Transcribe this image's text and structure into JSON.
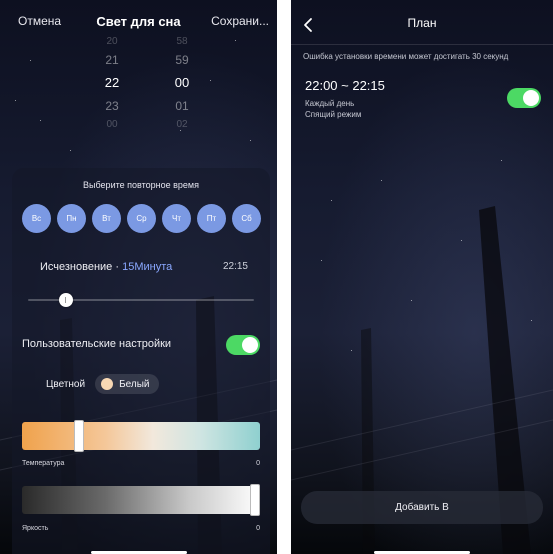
{
  "left_screen": {
    "header": {
      "cancel_label": "Отмена",
      "title": "Свет для сна",
      "save_label": "Сохрани..."
    },
    "time_picker": {
      "hours": [
        "20",
        "21",
        "22",
        "23",
        "00"
      ],
      "minutes": [
        "58",
        "59",
        "00",
        "01",
        "02"
      ],
      "selected_hour": "22",
      "selected_minute": "00"
    },
    "repeat": {
      "title": "Выберите повторное время",
      "days": [
        "Вс",
        "Пн",
        "Вт",
        "Ср",
        "Чт",
        "Пт",
        "Сб"
      ]
    },
    "fade": {
      "label": "Исчезновение · ",
      "value": "15Минута",
      "end_time": "22:15",
      "slider_fraction": 0.17
    },
    "custom_settings": {
      "label": "Пользовательские настройки",
      "enabled": true
    },
    "color_mode": {
      "label": "Цветной",
      "chip_label": "Белый",
      "chip_color": "#f8d8b4"
    },
    "temperature": {
      "label": "Температура",
      "value": "0",
      "handle_fraction": 0.24
    },
    "brightness": {
      "label": "Яркость",
      "value": "0",
      "handle_fraction": 0.98
    },
    "colors": {
      "accent_blue": "#7b99e3",
      "toggle_green": "#4cd964",
      "fade_value": "#8aa8ff"
    }
  },
  "right_screen": {
    "header": {
      "back_icon": "chevron-left-icon",
      "title": "План"
    },
    "notice": "Ошибка установки времени может достигать 30 секунд",
    "schedule": {
      "time_range": "22:00 ~ 22:15",
      "repeat": "Каждый день",
      "mode": "Спящий режим",
      "enabled": true
    },
    "add_button_label": "Добавить В"
  }
}
